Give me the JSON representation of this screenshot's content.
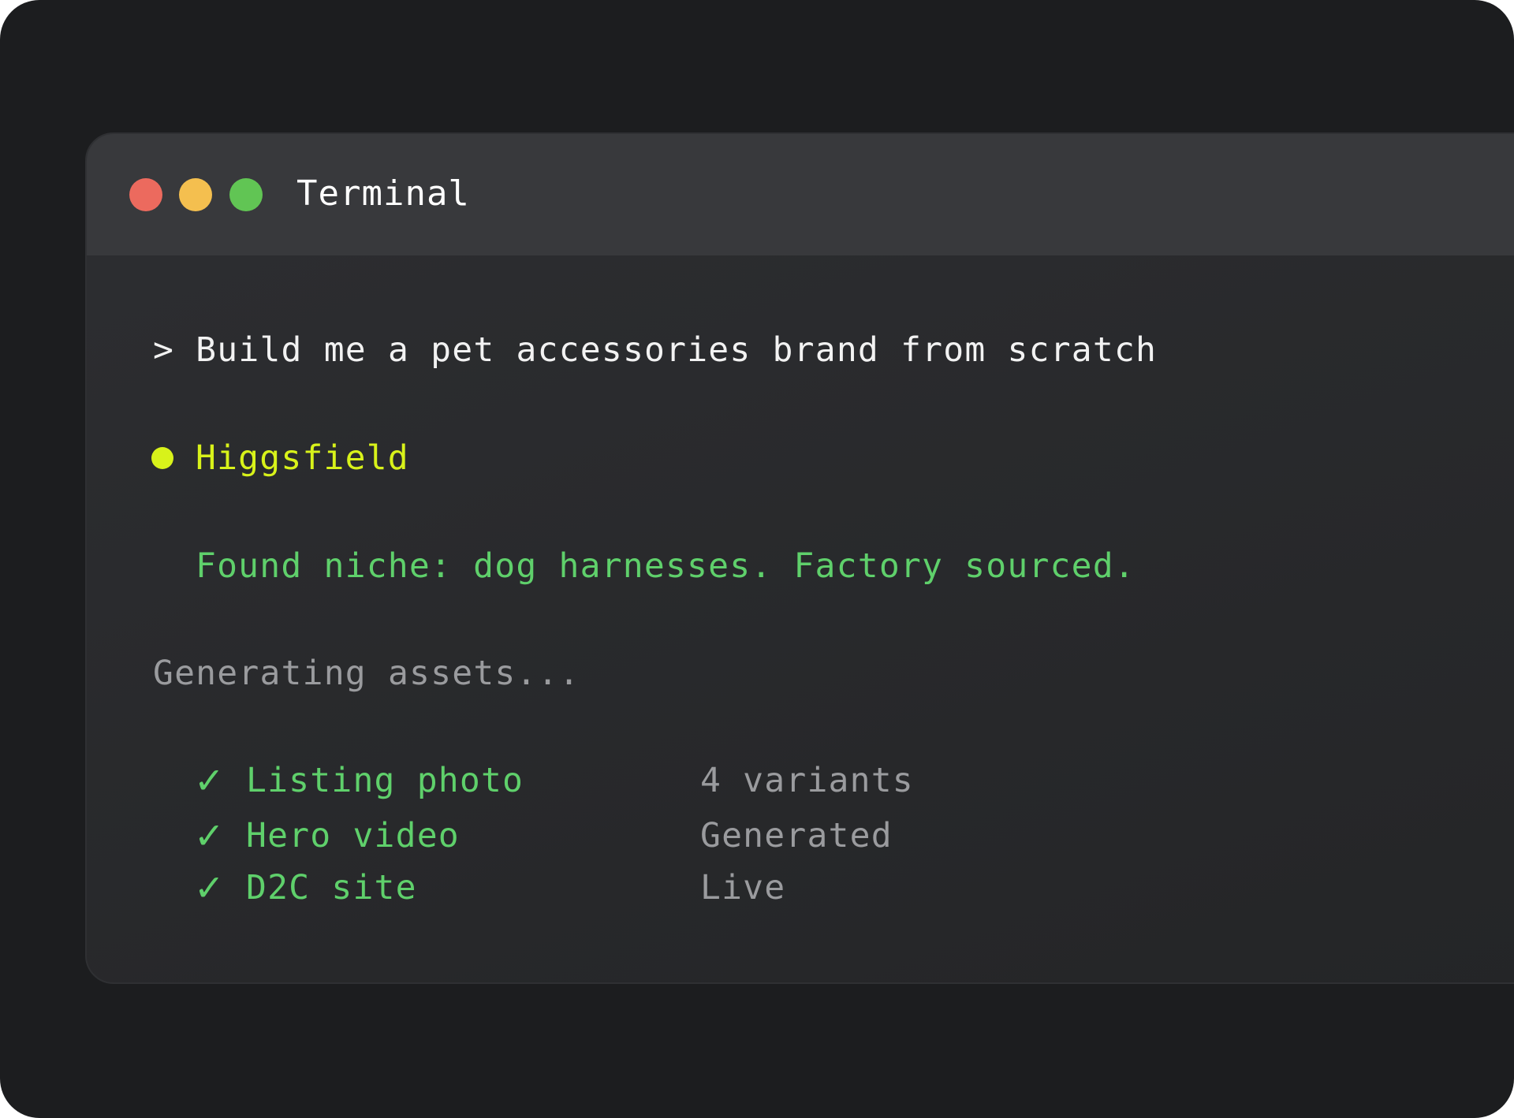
{
  "window": {
    "title": "Terminal",
    "controls": {
      "close_color": "#ec6a5e",
      "minimize_color": "#f4bf4f",
      "maximize_color": "#61c554"
    }
  },
  "terminal": {
    "prompt": "> Build me a pet accessories brand from scratch",
    "agent": {
      "name": "Higgsfield",
      "color": "#d8f21a"
    },
    "found_message": "Found niche: dog harnesses. Factory sourced.",
    "success_color": "#5fd06b",
    "status_line": "Generating assets...",
    "checklist": [
      {
        "check": "✓",
        "label": "Listing photo",
        "status": "4 variants"
      },
      {
        "check": "✓",
        "label": "Hero video",
        "status": "Generated"
      },
      {
        "check": "✓",
        "label": "D2C site",
        "status": "Live"
      }
    ]
  }
}
